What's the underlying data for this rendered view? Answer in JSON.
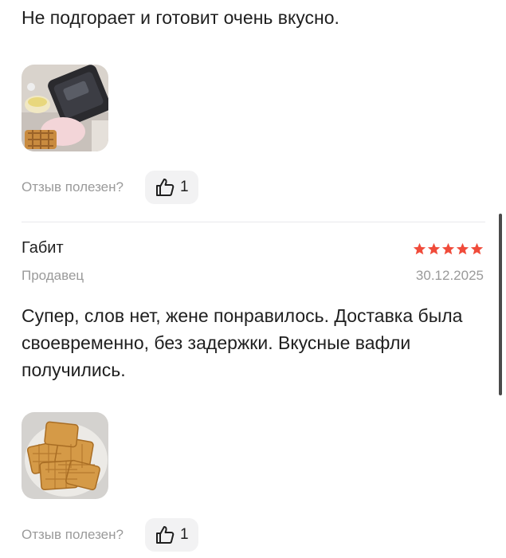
{
  "reviews": [
    {
      "text": "Не подгорает и готовит очень вкусно.",
      "helpful_label": "Отзыв полезен?",
      "likes": "1"
    },
    {
      "author": "Габит",
      "role": "Продавец",
      "date": "30.12.2025",
      "rating": 5,
      "text": "Супер, слов нет, жене понравилось. Доставка была своевременно, без задержки. Вкусные вафли получились.",
      "helpful_label": "Отзыв полезен?",
      "likes": "1"
    }
  ],
  "colors": {
    "star": "#f04b3a",
    "muted_text": "#9a9a9a",
    "button_bg": "#f2f2f3"
  },
  "icons": [
    "thumbs-up-icon",
    "star-icon"
  ]
}
